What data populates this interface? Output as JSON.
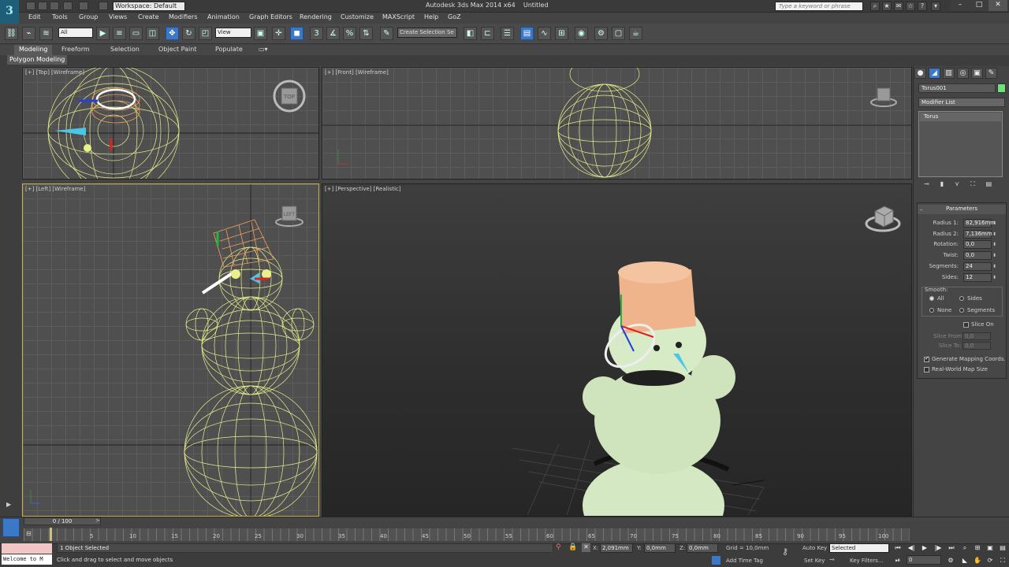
{
  "titlebar": {
    "workspace": "Workspace: Default",
    "title": "Autodesk 3ds Max 2014 x64",
    "doc": "Untitled",
    "search_placeholder": "Type a keyword or phrase"
  },
  "menu": [
    "Edit",
    "Tools",
    "Group",
    "Views",
    "Create",
    "Modifiers",
    "Animation",
    "Graph Editors",
    "Rendering",
    "Customize",
    "MAXScript",
    "Help",
    "GoZ"
  ],
  "toolbar": {
    "selection_filter": "All",
    "ref_coord": "View",
    "named_selection": "Create Selection Se"
  },
  "ribbon": {
    "tabs": [
      "Modeling",
      "Freeform",
      "Selection",
      "Object Paint",
      "Populate"
    ],
    "active_tab": "Modeling",
    "sub_label": "Polygon Modeling"
  },
  "viewports": {
    "top": "[+] [Top] [Wireframe]",
    "front": "[+] [Front] [Wireframe]",
    "left": "[+] [Left] [Wireframe]",
    "perspective": "[+] [Perspective] [Realistic]",
    "cube_top": "TOP",
    "cube_left": "LEFT"
  },
  "command_panel": {
    "object_name": "Torus001",
    "object_color": "#6fe07a",
    "modifier_list": "Modifier List",
    "stack_item": "Torus",
    "rollout_title": "Parameters",
    "params": [
      {
        "label": "Radius 1:",
        "value": "82,916mm"
      },
      {
        "label": "Radius 2:",
        "value": "7,136mm"
      },
      {
        "label": "Rotation:",
        "value": "0,0"
      },
      {
        "label": "Twist:",
        "value": "0,0"
      },
      {
        "label": "Segments:",
        "value": "24"
      },
      {
        "label": "Sides:",
        "value": "12"
      }
    ],
    "smooth_label": "Smooth:",
    "smooth_options": [
      "All",
      "Sides",
      "None",
      "Segments"
    ],
    "smooth_selected": "All",
    "slice_on": "Slice On",
    "slice_from": "Slice From:",
    "slice_to": "Slice To:",
    "slice_from_value": "0,0",
    "slice_to_value": "0,0",
    "gen_mapping": "Generate Mapping Coords.",
    "real_world": "Real-World Map Size"
  },
  "timeline": {
    "frame": "0 / 100",
    "ticks": [
      "5",
      "10",
      "15",
      "20",
      "25",
      "30",
      "35",
      "40",
      "45",
      "50",
      "55",
      "60",
      "65",
      "70",
      "75",
      "80",
      "85",
      "90",
      "95",
      "100"
    ]
  },
  "status": {
    "maxscript": "Welcome to M",
    "selected": "1 Object Selected",
    "prompt": "Click and drag to select and move objects",
    "x_label": "X:",
    "x_value": "2,091mm",
    "y_label": "Y:",
    "y_value": "0,0mm",
    "z_label": "Z:",
    "z_value": "0,0mm",
    "grid": "Grid = 10,0mm",
    "auto_key": "Auto Key",
    "set_key": "Set Key",
    "key_mode": "Selected",
    "key_filters": "Key Filters...",
    "add_time_tag": "Add Time Tag",
    "current_frame": "0"
  }
}
